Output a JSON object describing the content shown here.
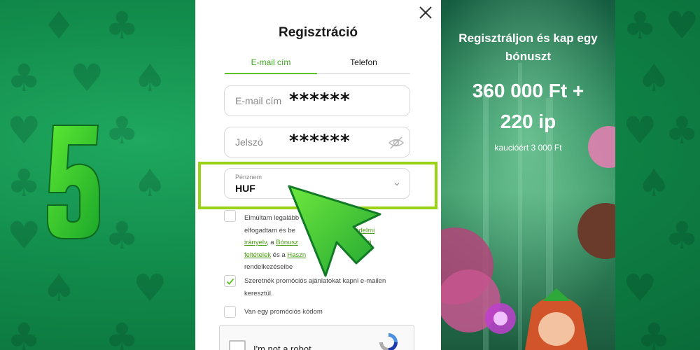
{
  "background": {
    "color": "#118a4a",
    "step_digit": "5"
  },
  "modal": {
    "title": "Regisztráció",
    "close_icon": "close-icon",
    "tabs": [
      {
        "label": "E-mail cím",
        "active": true
      },
      {
        "label": "Telefon",
        "active": false
      }
    ],
    "email_field": {
      "placeholder": "E-mail cím",
      "masked_value": "******"
    },
    "password_field": {
      "placeholder": "Jelszó",
      "masked_value": "******",
      "icon": "eye-slash-icon"
    },
    "currency_field": {
      "label": "Pénznem",
      "value": "HUF",
      "icon": "chevron-down-icon"
    },
    "terms": {
      "checked": false,
      "text_1": "Elmúltam legalább",
      "text_2": "elfogadtam és be",
      "link_privacy_a": "atvédelmi",
      "link_privacy_b": "irányelv",
      "text_3": ", a",
      "link_bonus": "Bónusz",
      "link_service_a": "olgálati",
      "link_service_b": "feltételek",
      "text_4": "és a",
      "link_usage": "Haszn",
      "text_5": "rendelkezéseibe"
    },
    "marketing": {
      "checked": true,
      "text": "Szeretnék promóciós ajánlatokat kapni e-mailen keresztül."
    },
    "promo_code": {
      "checked": false,
      "text": "Van egy promóciós kódom"
    },
    "captcha": {
      "label": "I'm not a robot"
    }
  },
  "promo": {
    "headline": "Regisztráljon és kap egy bónuszt",
    "amount_line_1": "360 000 Ft +",
    "amount_line_2": "220 ip",
    "subtext": "kaucióért 3 000 Ft"
  },
  "colors": {
    "accent": "#5cc125",
    "highlight": "#9ad316",
    "link": "#4a9c12"
  }
}
